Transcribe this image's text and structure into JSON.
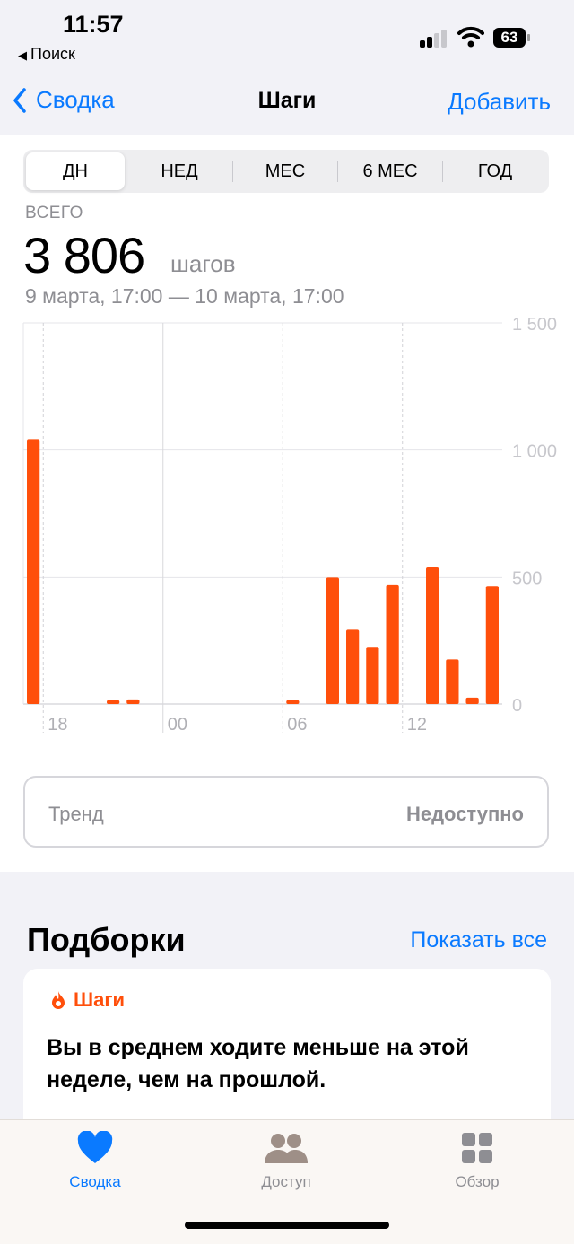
{
  "status_bar": {
    "time": "11:57",
    "back_app": "Поиск",
    "battery": "63"
  },
  "nav": {
    "back_label": "Сводка",
    "title": "Шаги",
    "add_label": "Добавить"
  },
  "segments": [
    "ДН",
    "НЕД",
    "МЕС",
    "6 МЕС",
    "ГОД"
  ],
  "selected_segment": "ДН",
  "summary": {
    "total_label": "ВСЕГО",
    "total_value": "3 806",
    "unit": "шагов",
    "date_range": "9 марта, 17:00 — 10 марта, 17:00"
  },
  "chart_data": {
    "type": "bar",
    "title": "",
    "xlabel": "",
    "ylabel": "",
    "ylim": [
      0,
      1500
    ],
    "y_ticks": [
      1500,
      1000,
      500,
      0
    ],
    "y_tick_labels": [
      "1 500",
      "1 000",
      "500",
      "0"
    ],
    "x_tick_labels": [
      "18",
      "00",
      "06",
      "12"
    ],
    "x_tick_hours": [
      1,
      7,
      13,
      19
    ],
    "grid": true,
    "bar_color": "#ff4f0b",
    "hours": [
      "17:00",
      "18:00",
      "19:00",
      "20:00",
      "21:00",
      "22:00",
      "23:00",
      "00:00",
      "01:00",
      "02:00",
      "03:00",
      "04:00",
      "05:00",
      "06:00",
      "07:00",
      "08:00",
      "09:00",
      "10:00",
      "11:00",
      "12:00",
      "13:00",
      "14:00",
      "15:00",
      "16:00"
    ],
    "values": [
      1040,
      0,
      0,
      0,
      15,
      18,
      0,
      0,
      0,
      0,
      0,
      0,
      0,
      15,
      0,
      500,
      295,
      225,
      470,
      0,
      540,
      175,
      25,
      465
    ]
  },
  "trend": {
    "label": "Тренд",
    "value": "Недоступно"
  },
  "highlights": {
    "title": "Подборки",
    "show_all": "Показать все",
    "card": {
      "category": "Шаги",
      "text": "Вы в среднем ходите меньше на этой неделе, чем на прошлой."
    }
  },
  "tabbar": [
    {
      "label": "Сводка",
      "icon": "heart-icon",
      "active": true
    },
    {
      "label": "Доступ",
      "icon": "people-icon",
      "active": false
    },
    {
      "label": "Обзор",
      "icon": "grid-icon",
      "active": false
    }
  ],
  "colors": {
    "accent": "#0a7aff",
    "steps": "#ff4f0b",
    "secondary_text": "#8e8e93"
  }
}
